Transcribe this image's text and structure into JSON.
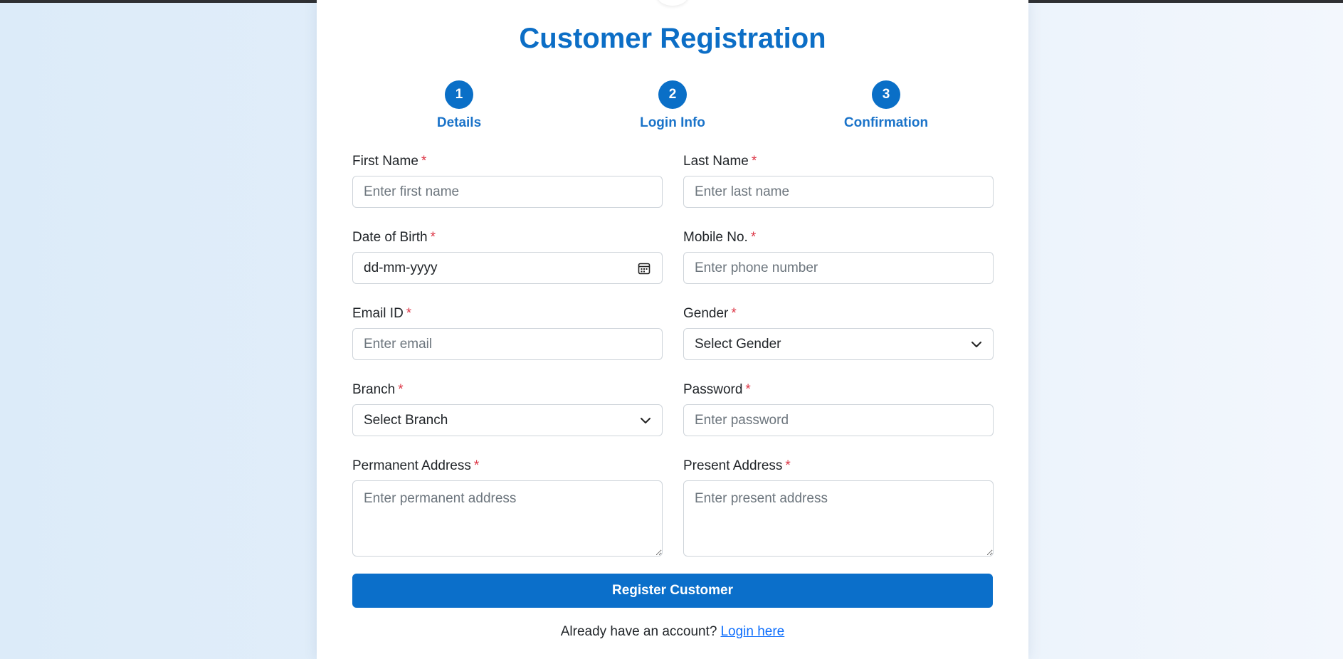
{
  "form": {
    "title": "Customer Registration",
    "required_mark": "*"
  },
  "steps": [
    {
      "number": "1",
      "label": "Details"
    },
    {
      "number": "2",
      "label": "Login Info"
    },
    {
      "number": "3",
      "label": "Confirmation"
    }
  ],
  "fields": {
    "first_name": {
      "label": "First Name",
      "placeholder": "Enter first name"
    },
    "last_name": {
      "label": "Last Name",
      "placeholder": "Enter last name"
    },
    "dob": {
      "label": "Date of Birth",
      "value": "dd-mm-yyyy",
      "icon": "calendar-icon"
    },
    "mobile": {
      "label": "Mobile No.",
      "placeholder": "Enter phone number"
    },
    "email": {
      "label": "Email ID",
      "placeholder": "Enter email"
    },
    "gender": {
      "label": "Gender",
      "selected": "Select Gender",
      "icon": "chevron-down-icon"
    },
    "branch": {
      "label": "Branch",
      "selected": "Select Branch",
      "icon": "chevron-down-icon"
    },
    "password": {
      "label": "Password",
      "placeholder": "Enter password"
    },
    "permanent_address": {
      "label": "Permanent Address",
      "placeholder": "Enter permanent address"
    },
    "present_address": {
      "label": "Present Address",
      "placeholder": "Enter present address"
    }
  },
  "actions": {
    "register_label": "Register Customer",
    "login_prompt": "Already have an account?",
    "login_link": "Login here"
  },
  "colors": {
    "primary": "#0b6fca",
    "required": "#dc3545",
    "link": "#0d6efd"
  }
}
